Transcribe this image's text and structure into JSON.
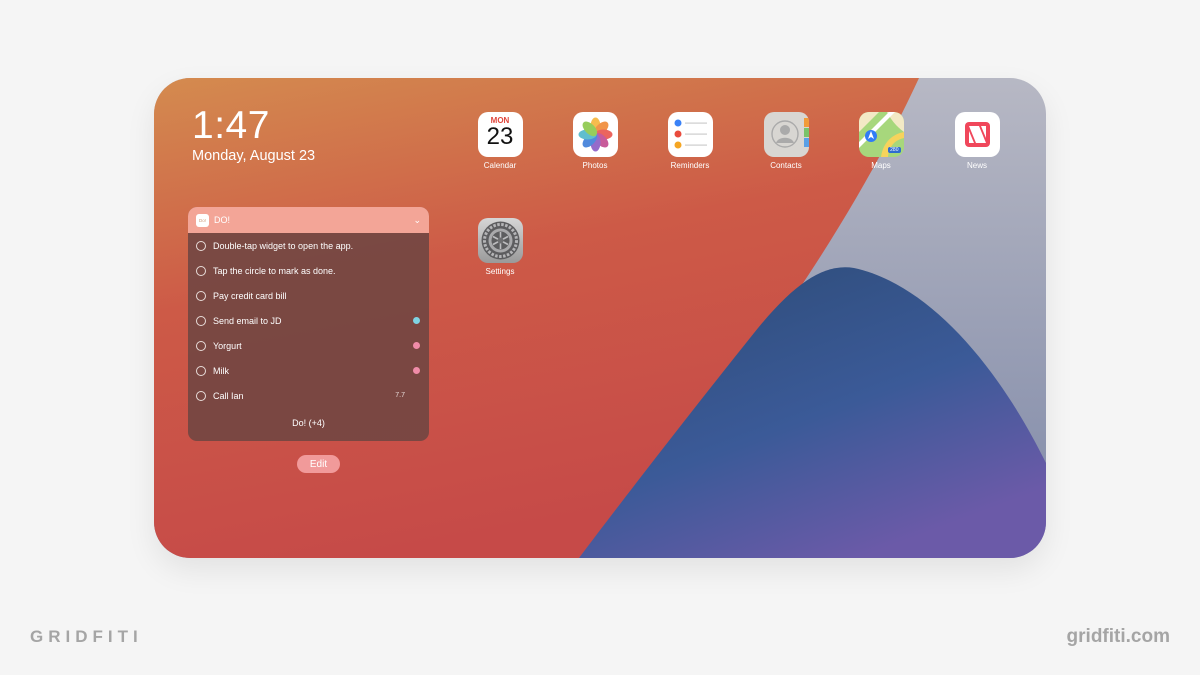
{
  "status": {
    "time": "1:47",
    "date": "Monday, August 23"
  },
  "widget": {
    "app_icon_text": "Do!",
    "title": "DO!",
    "items": [
      {
        "text": "Double-tap widget to open the app.",
        "dot": "",
        "meta": ""
      },
      {
        "text": "Tap the circle to mark as done.",
        "dot": "",
        "meta": ""
      },
      {
        "text": "Pay credit card bill",
        "dot": "",
        "meta": ""
      },
      {
        "text": "Send email to JD",
        "dot": "#7fd3e3",
        "meta": ""
      },
      {
        "text": "Yorgurt",
        "dot": "#f08ca8",
        "meta": ""
      },
      {
        "text": "Milk",
        "dot": "#f08ca8",
        "meta": ""
      },
      {
        "text": "Call Ian",
        "dot": "",
        "meta": "7.7"
      }
    ],
    "footer": "Do! (+4)"
  },
  "edit_label": "Edit",
  "apps": {
    "calendar": {
      "label": "Calendar",
      "month": "MON",
      "day": "23"
    },
    "photos": {
      "label": "Photos"
    },
    "reminders": {
      "label": "Reminders"
    },
    "contacts": {
      "label": "Contacts"
    },
    "maps": {
      "label": "Maps",
      "badge": "280"
    },
    "news": {
      "label": "News"
    },
    "settings": {
      "label": "Settings"
    }
  },
  "brand": {
    "left": "GRIDFITI",
    "right": "gridfiti.com"
  }
}
